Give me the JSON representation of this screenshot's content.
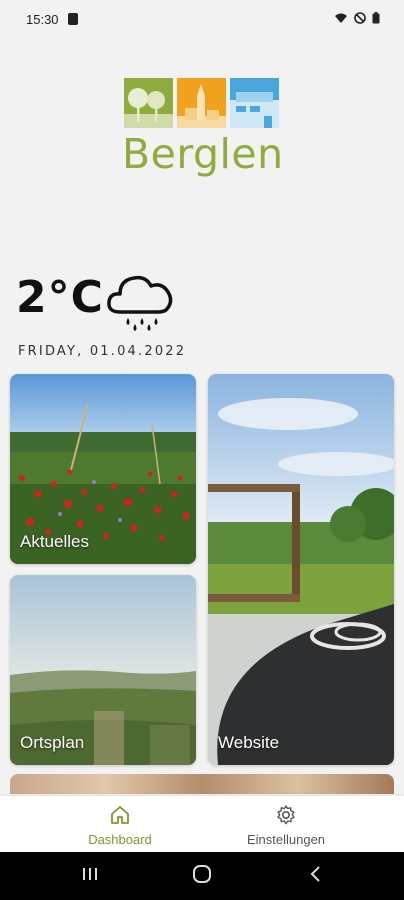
{
  "status_bar": {
    "time": "15:30"
  },
  "logo": {
    "text": "Berglen",
    "colors": {
      "green": "#8fac3e",
      "orange": "#f0a21e",
      "blue": "#4aa6dc"
    }
  },
  "weather": {
    "temperature": "2°C",
    "condition_icon": "rain-cloud-icon",
    "date": "FRIDAY, 01.04.2022"
  },
  "tiles": [
    {
      "label": "Aktuelles"
    },
    {
      "label": "Website"
    },
    {
      "label": "Ortsplan"
    }
  ],
  "bottom_nav": {
    "items": [
      {
        "label": "Dashboard",
        "icon": "home-icon",
        "active": true
      },
      {
        "label": "Einstellungen",
        "icon": "gear-icon",
        "active": false
      }
    ],
    "accent": "#7a9a2e"
  },
  "system_nav": {
    "buttons": [
      "recents-icon",
      "home-button-icon",
      "back-icon"
    ]
  }
}
